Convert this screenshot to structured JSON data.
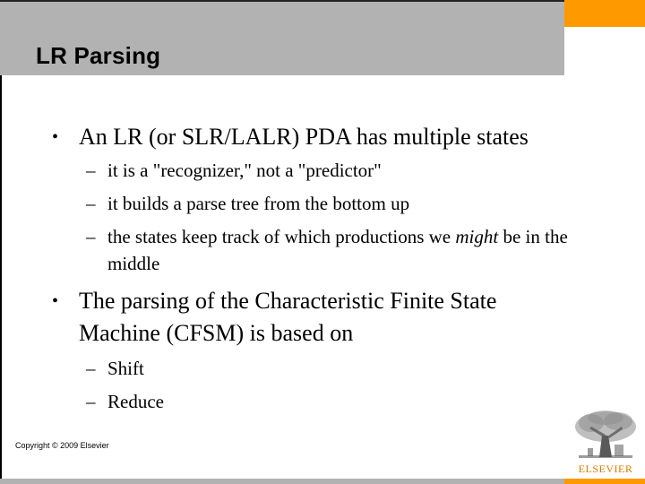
{
  "slide": {
    "title": "LR Parsing",
    "bullets": [
      {
        "text": "An LR (or SLR/LALR) PDA has multiple states",
        "sub": [
          {
            "pre": "it is a \"recognizer,\" not a \"predictor\"",
            "em": "",
            "post": ""
          },
          {
            "pre": "it builds a parse tree from the bottom up",
            "em": "",
            "post": ""
          },
          {
            "pre": "the states keep track of which productions we ",
            "em": "might",
            "post": " be in the middle"
          }
        ]
      },
      {
        "text": "The parsing of the Characteristic Finite State Machine (CFSM) is based on",
        "sub": [
          {
            "pre": "Shift",
            "em": "",
            "post": ""
          },
          {
            "pre": "Reduce",
            "em": "",
            "post": ""
          }
        ]
      }
    ],
    "bullet_glyph": "•",
    "sub_glyph": "–",
    "copyright": "Copyright © 2009 Elsevier"
  },
  "logo": {
    "icon": "elsevier-tree-icon",
    "wordmark": "ELSEVIER"
  },
  "colors": {
    "header_gray": "#b2b2b2",
    "accent_orange": "#ff9900",
    "logo_text": "#e07b00"
  }
}
